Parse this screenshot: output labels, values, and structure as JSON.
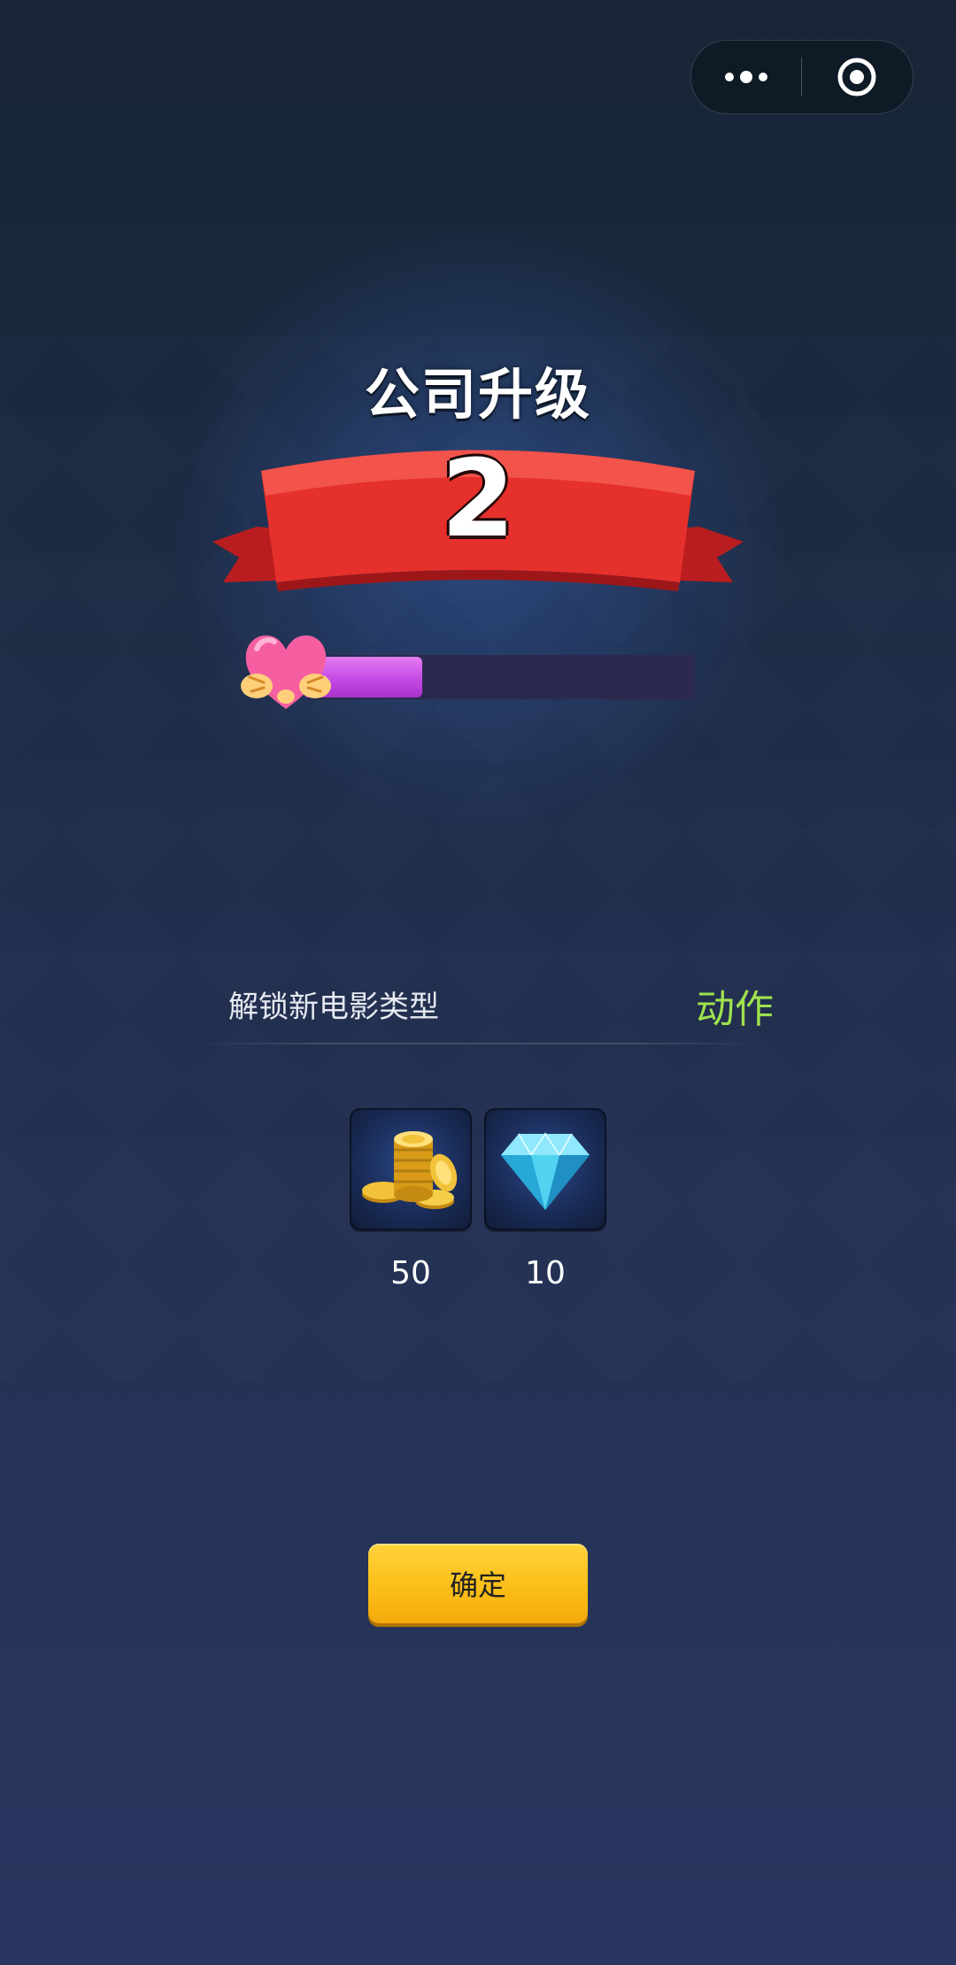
{
  "header": {
    "title": "公司升级",
    "level": "2"
  },
  "progress": {
    "fraction": 0.3
  },
  "unlock": {
    "label": "解锁新电影类型",
    "value": "动作"
  },
  "rewards": [
    {
      "icon": "gold-coins-icon",
      "amount": "50"
    },
    {
      "icon": "diamond-icon",
      "amount": "10"
    }
  ],
  "buttons": {
    "confirm_label": "确定"
  },
  "colors": {
    "ribbon": "#e5302c",
    "progress_fill": "#c54ae4",
    "unlock_value": "#9fe24d",
    "confirm_button": "#fbbd16"
  }
}
